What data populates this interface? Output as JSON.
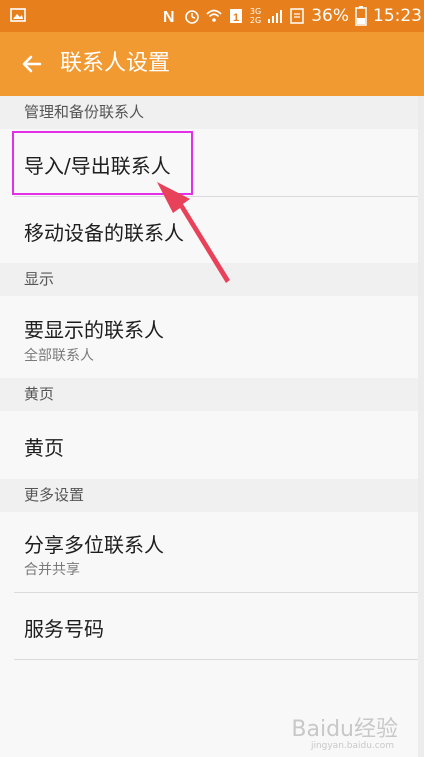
{
  "status_bar": {
    "battery_percent": "36%",
    "time": "15:23",
    "network_labels": [
      "3G",
      "2G"
    ],
    "icons": [
      "image-icon",
      "nfc-icon",
      "alarm-icon",
      "wifi-icon",
      "sim-1-icon",
      "signal-icon",
      "notes-icon",
      "battery-icon"
    ]
  },
  "app_bar": {
    "title": "联系人设置",
    "back_icon": "arrow-left-icon",
    "background_color": "#f29a32",
    "status_color": "#e67f1c"
  },
  "sections": [
    {
      "header": "管理和备份联系人",
      "items": [
        {
          "title": "导入/导出联系人"
        },
        {
          "title": "移动设备的联系人"
        }
      ]
    },
    {
      "header": "显示",
      "items": [
        {
          "title": "要显示的联系人",
          "subtitle": "全部联系人"
        }
      ]
    },
    {
      "header": "黄页",
      "items": [
        {
          "title": "黄页"
        }
      ]
    },
    {
      "header": "更多设置",
      "items": [
        {
          "title": "分享多位联系人",
          "subtitle": "合并共享"
        },
        {
          "title": "服务号码"
        }
      ]
    }
  ],
  "annotation": {
    "highlight_color": "#e32fe8",
    "arrow_color": "#e8425a"
  },
  "watermark": {
    "text": "Baidu经验",
    "sub": "jingyan.baidu.com"
  }
}
